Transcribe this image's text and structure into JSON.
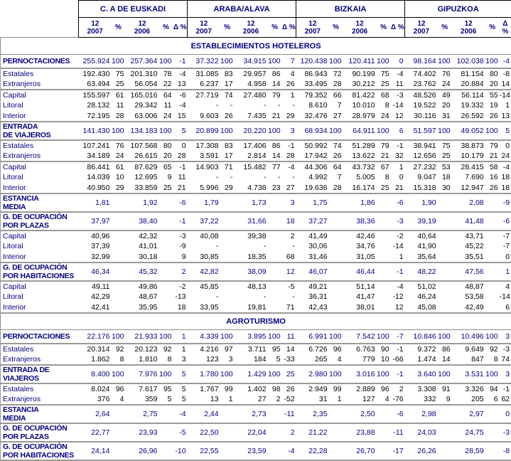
{
  "chart_data": {
    "type": "table",
    "regions": [
      "C. A DE EUSKADI",
      "ARABA/ALAVA",
      "BIZKAIA",
      "GIPUZKOA"
    ],
    "subcols": [
      "12\n2007",
      "%",
      "12\n2006",
      "%",
      "Δ %"
    ],
    "colors": {
      "text_navy": "#000080",
      "text_black": "#000000",
      "border_black": "#000000",
      "border_gray": "#9a9a9a"
    },
    "sections": [
      {
        "title": "ESTABLECIMIENTOS HOTELEROS",
        "rows": [
          {
            "label": "PERNOCTACIONES",
            "b": 1,
            "sep": 1,
            "h": "g",
            "cells": [
              "255.924",
              "100",
              "257.364",
              "100",
              "-1",
              "37.322",
              "100",
              "34.915",
              "100",
              "7",
              "120.438",
              "100",
              "120.411",
              "100",
              "0",
              "98.164",
              "100",
              "102.038",
              "100",
              "-4"
            ]
          },
          {
            "label": "Estatales",
            "cells": [
              "192.430",
              "75",
              "201.310",
              "78",
              "-4",
              "31.085",
              "83",
              "29.957",
              "86",
              "4",
              "86.943",
              "72",
              "90.199",
              "75",
              "-4",
              "74.402",
              "76",
              "81.154",
              "80",
              "-8"
            ]
          },
          {
            "label": "Extranjeros",
            "sep": 1,
            "cells": [
              "63.494",
              "25",
              "56.054",
              "22",
              "13",
              "6.237",
              "17",
              "4.958",
              "14",
              "26",
              "33.495",
              "28",
              "30.212",
              "25",
              "11",
              "23.762",
              "24",
              "20.884",
              "20",
              "14"
            ]
          },
          {
            "label": "Capital",
            "cells": [
              "155.597",
              "61",
              "165.016",
              "64",
              "-6",
              "27.719",
              "74",
              "27.480",
              "79",
              "1",
              "79.352",
              "66",
              "81.422",
              "68",
              "-3",
              "48.526",
              "49",
              "56.114",
              "55",
              "-14"
            ]
          },
          {
            "label": "Litoral",
            "cells": [
              "28.132",
              "11",
              "29.342",
              "11",
              "-4",
              "-",
              "-",
              "-",
              "-",
              "-",
              "8.610",
              "7",
              "10.010",
              "8",
              "-14",
              "19.522",
              "20",
              "19.332",
              "19",
              "1"
            ]
          },
          {
            "label": "Interior",
            "sep": 1,
            "cells": [
              "72.195",
              "28",
              "63.006",
              "24",
              "15",
              "9.603",
              "26",
              "7.435",
              "21",
              "29",
              "32.476",
              "27",
              "28.979",
              "24",
              "12",
              "30.116",
              "31",
              "26.592",
              "26",
              "13"
            ]
          },
          {
            "label": "ENTRADA\nDE VIAJEROS",
            "b": 1,
            "sep": 1,
            "h": "g2",
            "cells": [
              "141.430",
              "100",
              "134.183",
              "100",
              "5",
              "20.899",
              "100",
              "20.220",
              "100",
              "3",
              "68.934",
              "100",
              "64.911",
              "100",
              "6",
              "51.597",
              "100",
              "49.052",
              "100",
              "5"
            ]
          },
          {
            "label": "Estatales",
            "cells": [
              "107.241",
              "76",
              "107.568",
              "80",
              "0",
              "17.308",
              "83",
              "17.406",
              "86",
              "-1",
              "50.992",
              "74",
              "51.289",
              "79",
              "-1",
              "38.941",
              "75",
              "38.873",
              "79",
              "0"
            ]
          },
          {
            "label": "Extranjeros",
            "sep": 1,
            "cells": [
              "34.189",
              "24",
              "26.615",
              "20",
              "28",
              "3.591",
              "17",
              "2.814",
              "14",
              "28",
              "17.942",
              "26",
              "13.622",
              "21",
              "32",
              "12.656",
              "25",
              "10.179",
              "21",
              "24"
            ]
          },
          {
            "label": "Capital",
            "cells": [
              "86.441",
              "61",
              "87.629",
              "65",
              "-1",
              "14.903",
              "71",
              "15.482",
              "77",
              "-4",
              "44.306",
              "64",
              "43.732",
              "67",
              "1",
              "27.232",
              "53",
              "28.415",
              "58",
              "-4"
            ]
          },
          {
            "label": "Litoral",
            "cells": [
              "14.039",
              "10",
              "12.695",
              "9",
              "11",
              "-",
              "-",
              "-",
              "-",
              "-",
              "4.992",
              "7",
              "5.005",
              "8",
              "0",
              "9.047",
              "18",
              "7.690",
              "16",
              "18"
            ]
          },
          {
            "label": "Interior",
            "sep": 1,
            "cells": [
              "40.950",
              "29",
              "33.859",
              "25",
              "21",
              "5.996",
              "29",
              "4.738",
              "23",
              "27",
              "19.636",
              "28",
              "16.174",
              "25",
              "21",
              "15.318",
              "30",
              "12.947",
              "26",
              "18"
            ]
          },
          {
            "label": "ESTANCIA\nMEDIA",
            "b": 1,
            "sep": 1,
            "h": "g2",
            "cells": [
              "1,81",
              "",
              "1,92",
              "",
              "-6",
              "1,79",
              "",
              "1,73",
              "",
              "3",
              "1,75",
              "",
              "1,86",
              "",
              "-6",
              "1,90",
              "",
              "2,08",
              "",
              "-9"
            ]
          },
          {
            "label": "G. DE OCUPACIÓN\nPOR PLAZAS",
            "b": 1,
            "sep": 1,
            "h": "g2",
            "cells": [
              "37,97",
              "",
              "38,40",
              "",
              "-1",
              "37,22",
              "",
              "31,66",
              "",
              "18",
              "37,27",
              "",
              "38,36",
              "",
              "-3",
              "39,19",
              "",
              "41,48",
              "",
              "-6"
            ]
          },
          {
            "label": "Capital",
            "cells": [
              "40,96",
              "",
              "42,32",
              "",
              "-3",
              "40,08",
              "",
              "39,38",
              "",
              "2",
              "41,49",
              "",
              "42,46",
              "",
              "-2",
              "40,64",
              "",
              "43,71",
              "",
              "-7"
            ]
          },
          {
            "label": "Litoral",
            "cells": [
              "37,39",
              "",
              "41,01",
              "",
              "-9",
              "-",
              "",
              "-",
              "",
              "-",
              "30,06",
              "",
              "34,76",
              "",
              "-14",
              "41,90",
              "",
              "45,22",
              "",
              "-7"
            ]
          },
          {
            "label": "Interior",
            "sep": 1,
            "cells": [
              "32,99",
              "",
              "30,18",
              "",
              "9",
              "30,85",
              "",
              "18,35",
              "",
              "68",
              "31,46",
              "",
              "31,05",
              "",
              "1",
              "35,64",
              "",
              "35,51",
              "",
              "0"
            ]
          },
          {
            "label": "G. DE OCUPACIÓN\nPOR HABITACIONES",
            "b": 1,
            "sep": 1,
            "h": "g2",
            "cells": [
              "46,34",
              "",
              "45,32",
              "",
              "2",
              "42,82",
              "",
              "38,09",
              "",
              "12",
              "46,07",
              "",
              "46,44",
              "",
              "-1",
              "48,22",
              "",
              "47,56",
              "",
              "1"
            ]
          },
          {
            "label": "Capital",
            "cells": [
              "49,11",
              "",
              "49,86",
              "",
              "-2",
              "45,85",
              "",
              "48,13",
              "",
              "-5",
              "49,21",
              "",
              "51,14",
              "",
              "-4",
              "51,02",
              "",
              "48,87",
              "",
              "4"
            ]
          },
          {
            "label": "Litoral",
            "cells": [
              "42,29",
              "",
              "48,67",
              "",
              "-13",
              "-",
              "",
              "-",
              "",
              "-",
              "36,31",
              "",
              "41,47",
              "",
              "-12",
              "46,24",
              "",
              "53,58",
              "",
              "-14"
            ]
          },
          {
            "label": "Interior",
            "sep": 1,
            "cells": [
              "42,41",
              "",
              "35,95",
              "",
              "18",
              "33,95",
              "",
              "19,81",
              "",
              "71",
              "42,43",
              "",
              "38,01",
              "",
              "12",
              "45,08",
              "",
              "42,49",
              "",
              "6"
            ]
          }
        ]
      },
      {
        "title": "AGROTURISMO",
        "rows": [
          {
            "label": "PERNOCTACIONES",
            "b": 1,
            "sep": 1,
            "h": "g",
            "cells": [
              "22.176",
              "100",
              "21.933",
              "100",
              "1",
              "4.339",
              "100",
              "3.895",
              "100",
              "11",
              "6.991",
              "100",
              "7.542",
              "100",
              "-7",
              "10.846",
              "100",
              "10.496",
              "100",
              "3"
            ]
          },
          {
            "label": "Estatales",
            "cells": [
              "20.314",
              "92",
              "20.123",
              "92",
              "1",
              "4.216",
              "97",
              "3.711",
              "95",
              "14",
              "6.726",
              "96",
              "6.763",
              "90",
              "-1",
              "9.372",
              "86",
              "9.649",
              "92",
              "-3"
            ]
          },
          {
            "label": "Extranjeros",
            "sep": 1,
            "cells": [
              "1.862",
              "8",
              "1.810",
              "8",
              "3",
              "123",
              "3",
              "184",
              "5",
              "-33",
              "265",
              "4",
              "779",
              "10",
              "-66",
              "1.474",
              "14",
              "847",
              "8",
              "74"
            ]
          },
          {
            "label": "ENTRADA DE\nVIAJEROS",
            "b": 1,
            "sep": 1,
            "h": "g2",
            "cells": [
              "8.400",
              "100",
              "7.976",
              "100",
              "5",
              "1.780",
              "100",
              "1.429",
              "100",
              "25",
              "2.980",
              "100",
              "3.016",
              "100",
              "-1",
              "3.640",
              "100",
              "3.531",
              "100",
              "3"
            ]
          },
          {
            "label": "Estatales",
            "cells": [
              "8.024",
              "96",
              "7.617",
              "95",
              "5",
              "1.767",
              "99",
              "1.402",
              "98",
              "26",
              "2.949",
              "99",
              "2.889",
              "96",
              "2",
              "3.308",
              "91",
              "3.326",
              "94",
              "-1"
            ]
          },
          {
            "label": "Extranjeros",
            "sep": 1,
            "cells": [
              "376",
              "4",
              "359",
              "5",
              "5",
              "13",
              "1",
              "27",
              "2",
              "-52",
              "31",
              "1",
              "127",
              "4",
              "-76",
              "332",
              "9",
              "205",
              "6",
              "62"
            ]
          },
          {
            "label": "ESTANCIA\nMEDIA",
            "b": 1,
            "sep": 1,
            "h": "g2",
            "cells": [
              "2,64",
              "",
              "2,75",
              "",
              "-4",
              "2,44",
              "",
              "2,73",
              "",
              "-11",
              "2,35",
              "",
              "2,50",
              "",
              "-6",
              "2,98",
              "",
              "2,97",
              "",
              "0"
            ]
          },
          {
            "label": "G. DE OCUPACIÓN\nPOR PLAZAS",
            "b": 1,
            "sep": 1,
            "h": "g2",
            "cells": [
              "22,77",
              "",
              "23,93",
              "",
              "-5",
              "22,50",
              "",
              "22,04",
              "",
              "2",
              "21,22",
              "",
              "23,88",
              "",
              "-11",
              "24,03",
              "",
              "24,75",
              "",
              "-3"
            ]
          },
          {
            "label": "G. DE OCUPACIÓN\nPOR HABITACIONES",
            "b": 1,
            "sep": 1,
            "h": "g2",
            "cells": [
              "24,14",
              "",
              "26,96",
              "",
              "-10",
              "22,55",
              "",
              "23,59",
              "",
              "-4",
              "22,28",
              "",
              "26,70",
              "",
              "-17",
              "26,26",
              "",
              "28,59",
              "",
              "-8"
            ]
          }
        ]
      }
    ]
  }
}
